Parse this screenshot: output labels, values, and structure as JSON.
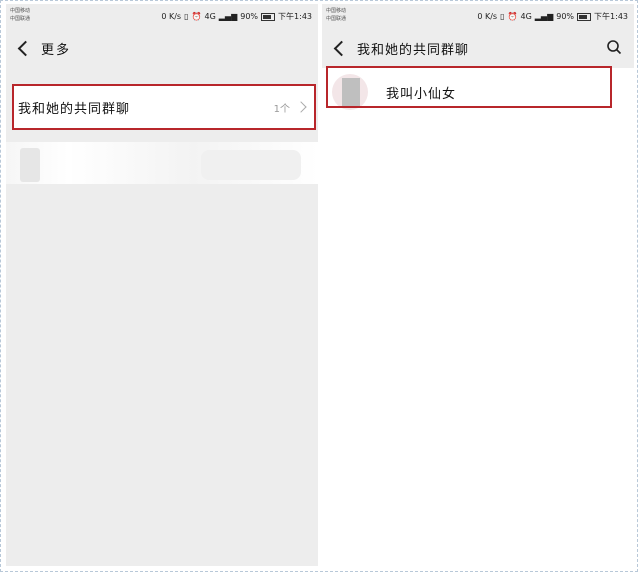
{
  "status_bar": {
    "carrier_1": "中国移动",
    "carrier_2": "中国联通",
    "speed": "0 K/s",
    "signal_text": "4G",
    "battery": "90%",
    "time": "下午1:43"
  },
  "left_panel": {
    "title": "更多",
    "group_row": {
      "label": "我和她的共同群聊",
      "count": "1个"
    }
  },
  "right_panel": {
    "title": "我和她的共同群聊",
    "chats": [
      {
        "name": "我叫小仙女"
      }
    ]
  },
  "colors": {
    "highlight": "#b8262b",
    "bg_gray": "#ededed"
  }
}
